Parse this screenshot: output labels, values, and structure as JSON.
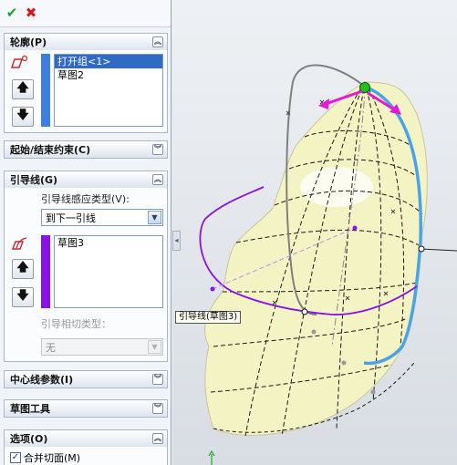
{
  "toolbar": {
    "ok_icon": "check-icon",
    "cancel_icon": "close-icon"
  },
  "profile": {
    "title": "轮廓(P)",
    "items": [
      "打开组<1>",
      "草图2"
    ],
    "selected_index": 0
  },
  "start_end": {
    "title": "起始/结束约束(C)"
  },
  "guides": {
    "title": "引导线(G)",
    "influence_label": "引导线感应类型(V):",
    "influence_value": "到下一引线",
    "items": [
      "草图3"
    ],
    "tangency_label": "引导相切类型：",
    "tangency_value": "无"
  },
  "centerline": {
    "title": "中心线参数(I)"
  },
  "sketch_tools": {
    "title": "草图工具"
  },
  "options": {
    "title": "选项(O)",
    "merge_faces_label": "合并切面(M)",
    "merge_faces_checked": true
  },
  "viewport": {
    "callout": "引导线(草图3)",
    "colors": {
      "accent": "#316ac5",
      "guide": "#8a2be2",
      "blue_edge": "#4aa3ea",
      "handle": "#e41bd2",
      "surface": "#f4f3c4"
    }
  }
}
